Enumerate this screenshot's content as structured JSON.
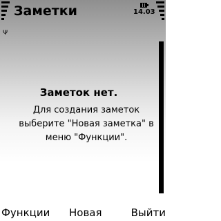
{
  "header": {
    "title": "Заметки",
    "clock": "14.03",
    "signal_icon": "signal-strength-icon",
    "battery_icon": "battery-icon"
  },
  "content": {
    "empty_title": "Заметок нет.",
    "empty_hint": "Для создания заметок выберите \"Новая заметка\" в меню \"Функции\"."
  },
  "softkeys": {
    "left": "Функции",
    "middle": "Новая",
    "right": "Выйти"
  },
  "colors": {
    "text": "#000000",
    "gradient_top": "#8f8f8f",
    "background": "#ffffff"
  }
}
